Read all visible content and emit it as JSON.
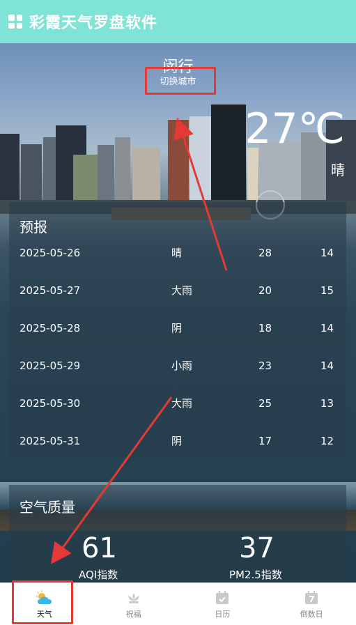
{
  "app": {
    "title": "彩霞天气罗盘软件"
  },
  "city": {
    "name": "闵行",
    "switch_label": "切换城市"
  },
  "current": {
    "temperature": "27℃",
    "condition": "晴"
  },
  "forecast": {
    "heading": "预报",
    "rows": [
      {
        "date": "2025-05-26",
        "weather": "晴",
        "high": "28",
        "low": "14"
      },
      {
        "date": "2025-05-27",
        "weather": "大雨",
        "high": "20",
        "low": "15"
      },
      {
        "date": "2025-05-28",
        "weather": "阴",
        "high": "18",
        "low": "14"
      },
      {
        "date": "2025-05-29",
        "weather": "小雨",
        "high": "23",
        "low": "14"
      },
      {
        "date": "2025-05-30",
        "weather": "大雨",
        "high": "25",
        "low": "13"
      },
      {
        "date": "2025-05-31",
        "weather": "阴",
        "high": "17",
        "low": "12"
      }
    ]
  },
  "air_quality": {
    "heading": "空气质量",
    "aqi_value": "61",
    "aqi_label": "AQI指数",
    "pm25_value": "37",
    "pm25_label": "PM2.5指数"
  },
  "tabs": [
    {
      "label": "天气",
      "icon": "weather-icon",
      "active": true
    },
    {
      "label": "祝福",
      "icon": "lotus-icon",
      "active": false
    },
    {
      "label": "日历",
      "icon": "calendar-icon",
      "active": false
    },
    {
      "label": "倒数日",
      "icon": "countdown-icon",
      "active": false
    }
  ],
  "colors": {
    "app_bar": "#7fe3d6",
    "highlight": "#e53935",
    "active_tab_icon": "#3fb6e8"
  }
}
